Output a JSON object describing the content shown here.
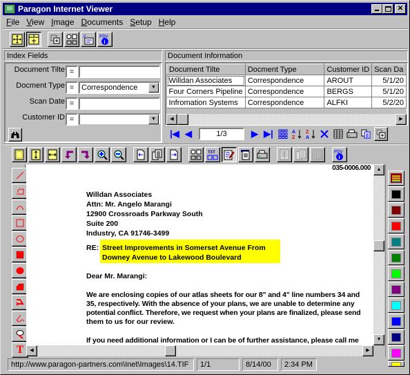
{
  "window": {
    "title": "Paragon Internet Viewer",
    "controls": {
      "minimize": "_",
      "maximize": "□",
      "close": "✕"
    }
  },
  "menu": [
    {
      "label": "File",
      "accel": "F"
    },
    {
      "label": "View",
      "accel": "V"
    },
    {
      "label": "Image",
      "accel": "I"
    },
    {
      "label": "Documents",
      "accel": "D"
    },
    {
      "label": "Setup",
      "accel": "S"
    },
    {
      "label": "Help",
      "accel": "H"
    }
  ],
  "main_toolbar": [
    {
      "name": "fit-view-icon"
    },
    {
      "name": "layout-view-icon",
      "pressed": true
    },
    {
      "name": "new-window-icon"
    },
    {
      "name": "options-icon"
    },
    {
      "name": "email-icon",
      "text": "E"
    },
    {
      "name": "pdv-info-icon",
      "text": "PDV"
    }
  ],
  "index_fields": {
    "header": "Index Fields",
    "fields": [
      {
        "label": "Document Tilte",
        "operator": "=",
        "value": "",
        "type": "text"
      },
      {
        "label": "Docment Type",
        "operator": "=",
        "value": "Correspondence",
        "type": "dropdown"
      },
      {
        "label": "Scan Date",
        "operator": "=",
        "value": "",
        "type": "text"
      },
      {
        "label": "Customer ID",
        "operator": "=",
        "value": "",
        "type": "dropdown"
      }
    ],
    "search_icon": "binoculars-icon"
  },
  "document_info": {
    "header": "Document Information",
    "columns": [
      "Document Tilte",
      "Docment Type",
      "Customer ID",
      "Scan Da"
    ],
    "rows": [
      [
        "Willdan Associates",
        "Correspondence",
        "AROUT",
        "5/1/20"
      ],
      [
        "Four Corners Pipeline",
        "Correspondence",
        "BERGS",
        "5/1/20"
      ],
      [
        "Infromation Systems",
        "Correspondence",
        "ALFKI",
        "5/2/20"
      ]
    ],
    "page_indicator": "1/3"
  },
  "image_toolbar": [
    {
      "name": "fit-page-icon"
    },
    {
      "name": "fit-height-icon"
    },
    {
      "name": "fit-width-icon"
    },
    {
      "name": "rotate-left-icon"
    },
    {
      "name": "rotate-right-icon"
    },
    {
      "name": "zoom-in-icon"
    },
    {
      "name": "zoom-out-icon"
    },
    {
      "name": "previous-page-icon"
    },
    {
      "name": "thumbnails-icon"
    },
    {
      "name": "next-page-icon"
    },
    {
      "name": "options-icon"
    },
    {
      "name": "text-view-icon",
      "text": "TXT"
    },
    {
      "name": "annotate-icon",
      "pressed": true
    },
    {
      "name": "properties-icon"
    },
    {
      "name": "print-icon"
    },
    {
      "name": "grid-1-icon",
      "disabled": true
    },
    {
      "name": "grid-2-icon",
      "disabled": true
    },
    {
      "name": "grid-3-icon",
      "disabled": true
    },
    {
      "name": "pdv-info-icon",
      "text": "PDV"
    }
  ],
  "annotation_tools": [
    {
      "name": "line-tool-icon"
    },
    {
      "name": "polyline-tool-icon"
    },
    {
      "name": "arc-tool-icon"
    },
    {
      "name": "rectangle-tool-icon"
    },
    {
      "name": "ellipse-tool-icon"
    },
    {
      "name": "filled-rectangle-tool-icon"
    },
    {
      "name": "filled-ellipse-tool-icon"
    },
    {
      "name": "filled-polygon-tool-icon"
    },
    {
      "name": "arrow-tool-icon"
    },
    {
      "name": "freehand-tool-icon"
    },
    {
      "name": "stamp-tool-icon"
    },
    {
      "name": "text-tool-icon"
    }
  ],
  "palette": {
    "highlighter_icon": "highlighter-icon",
    "colors": [
      "#000000",
      "#800000",
      "#ff0000",
      "#008080",
      "#008000",
      "#00ff00",
      "#800080",
      "#00ffff",
      "#0000ff",
      "#000080",
      "#ff00ff",
      "#ffff00"
    ]
  },
  "document": {
    "doc_number": "035-0006.000",
    "address": [
      "Willdan Associates",
      "Attn:  Mr. Angelo Marangi",
      "12900 Crossroads Parkway South",
      "Suite 200",
      "Industry, CA 91746-3499"
    ],
    "re_label": "RE:",
    "re_lines": [
      "Street Improvements in Somerset Avenue From",
      "Downey Avenue to Lakewood Boulevard"
    ],
    "highlight_color": "#ffff00",
    "salutation": "Dear Mr. Marangi:",
    "paragraph1": [
      "We are enclosing copies of our atlas sheets for our 8\" and 4\" line numbers 34 and",
      "35, respectively.  With the absence of your plans, we are unable to determine any",
      "potential conflict.  Therefore, we request when your plans are finalized, please send",
      "them to us for our review."
    ],
    "paragraph2": [
      "If you need additional information or I can be of further assistance, please call me"
    ]
  },
  "status_bar": {
    "path": "http://www.paragon-partners.com\\Inet\\Images\\14.TIF",
    "page": "1/1",
    "date": "8/14/00",
    "time": "2:34 PM"
  }
}
